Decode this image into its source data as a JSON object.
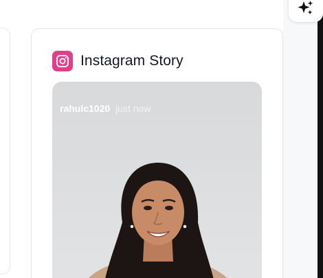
{
  "story_card": {
    "title": "Instagram Story",
    "icon": "instagram-icon",
    "accent": "#e0408a",
    "story": {
      "username": "rahulc1020",
      "time": "just now"
    }
  },
  "toolbar": {
    "ai_icon": "sparkles-icon"
  }
}
